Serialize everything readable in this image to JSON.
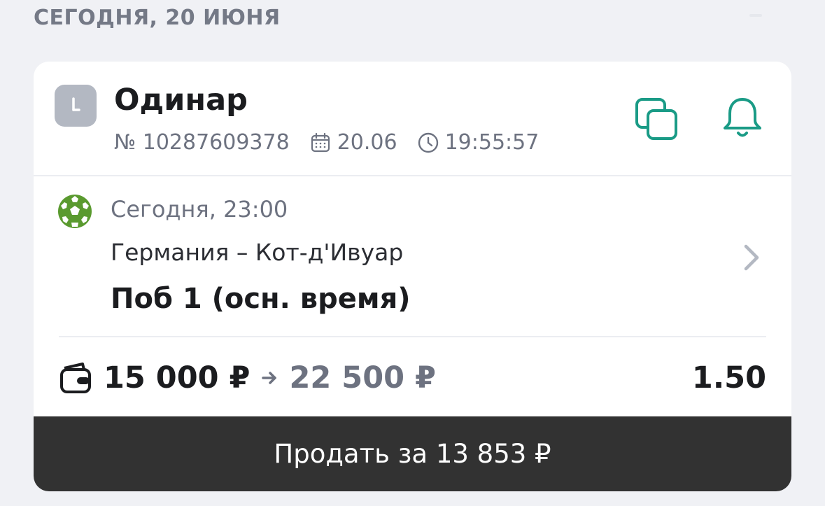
{
  "section": {
    "date_header": "СЕГОДНЯ, 20 ИЮНЯ"
  },
  "bet": {
    "type": "Одинар",
    "number": "№ 10287609378",
    "date": "20.06",
    "time": "19:55:57",
    "status_icon": "clock-icon",
    "actions": {
      "copy_icon": "copy-icon",
      "notify_icon": "bell-icon"
    },
    "event": {
      "sport_icon": "soccer-ball-icon",
      "start": "Сегодня, 23:00",
      "teams": "Германия – Кот-д'Ивуар",
      "outcome": "Поб 1 (осн. время)"
    },
    "stake": "15 000 ₽",
    "payout": "22 500 ₽",
    "coefficient": "1.50",
    "sell_label": "Продать за 13 853 ₽"
  },
  "colors": {
    "background": "#f0f1f5",
    "card": "#ffffff",
    "accent": "#1a9b86",
    "sport_green": "#5a9a2f",
    "muted_text": "#6d7280",
    "sell_button": "#323232"
  }
}
